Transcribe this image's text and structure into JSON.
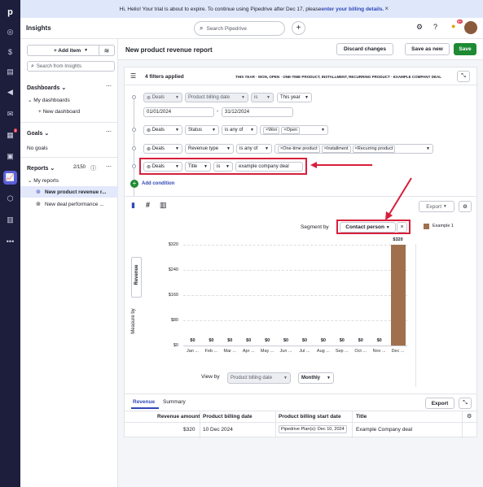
{
  "banner": {
    "text": "Hi, Helio! Your trial is about to expire. To continue using Pipedrive after Dec 17, please ",
    "link": "enter your billing details."
  },
  "app": {
    "title": "Insights",
    "logo": "p"
  },
  "search": {
    "placeholder": "Search Pipedrive"
  },
  "user": {
    "notification_count": "9+"
  },
  "sidebar": {
    "add_item": "+ Add item",
    "search_placeholder": "Search from Insights",
    "dashboards_title": "Dashboards",
    "my_dashboards": "My dashboards",
    "new_dashboard": "+ New dashboard",
    "goals_title": "Goals",
    "no_goals": "No goals",
    "reports_title": "Reports",
    "reports_count": "2/150",
    "my_reports": "My reports",
    "report_items": [
      "New product revenue r...",
      "New deal performance ..."
    ],
    "rail_badge": "3"
  },
  "header": {
    "title": "New product revenue report",
    "discard": "Discard changes",
    "save_as_new": "Save as new",
    "save": "Save"
  },
  "filters": {
    "applied": "4 filters applied",
    "summary": [
      "THIS YEAR",
      "WON, OPEN",
      "ONE-TIME PRODUCT, INSTALLMENT, RECURRING PRODUCT",
      "EXAMPLE COMPANY DEAL"
    ],
    "rows": [
      {
        "entity": "Deals",
        "field": "Product billing date",
        "op": "is",
        "value": "This year",
        "from": "01/01/2024",
        "dash": "-",
        "to": "31/12/2024"
      },
      {
        "entity": "Deals",
        "field": "Status",
        "op": "is any of",
        "tags": [
          "Won",
          "Open"
        ]
      },
      {
        "entity": "Deals",
        "field": "Revenue type",
        "op": "is any of",
        "tags": [
          "One-time product",
          "Installment",
          "Recurring product"
        ]
      },
      {
        "entity": "Deals",
        "field": "Title",
        "op": "is",
        "value": "example company deal"
      }
    ],
    "add_condition": "Add condition"
  },
  "chart_toolbar": {
    "export": "Export",
    "segment_by_label": "Segment by",
    "segment_value": "Contact person",
    "view_by_label": "View by",
    "view_by_value": "Product billing date",
    "interval": "Monthly",
    "measure_by": "Measure by",
    "measure_value": "Revenue"
  },
  "chart_data": {
    "type": "bar",
    "categories": [
      "Jan ...",
      "Feb ...",
      "Mar ...",
      "Apr ...",
      "May ...",
      "Jun ...",
      "Jul ...",
      "Aug ...",
      "Sep ...",
      "Oct ...",
      "Nov ...",
      "Dec ..."
    ],
    "series": [
      {
        "name": "Example 1",
        "values": [
          0,
          0,
          0,
          0,
          0,
          0,
          0,
          0,
          0,
          0,
          0,
          320
        ],
        "color": "#a0704e"
      }
    ],
    "value_labels": [
      "$0",
      "$0",
      "$0",
      "$0",
      "$0",
      "$0",
      "$0",
      "$0",
      "$0",
      "$0",
      "$0",
      "$320"
    ],
    "yticks": [
      "$320",
      "$240",
      "$160",
      "$80",
      "$0"
    ],
    "ylim": [
      0,
      320
    ]
  },
  "table": {
    "tabs": [
      "Revenue",
      "Summary"
    ],
    "export": "Export",
    "columns": [
      "Revenue amount",
      "Product billing date",
      "Product billing start date",
      "Title"
    ],
    "rows": [
      {
        "amount": "$320",
        "billing_date": "10 Dec 2024",
        "start_date": "Pipedrive Plan(s): Dec 10, 2024",
        "title": "Example Company deal"
      }
    ]
  },
  "colors": {
    "accent": "#2f49b8",
    "green": "#1f8a34",
    "highlight": "#d71f3a",
    "bar": "#a0704e"
  }
}
